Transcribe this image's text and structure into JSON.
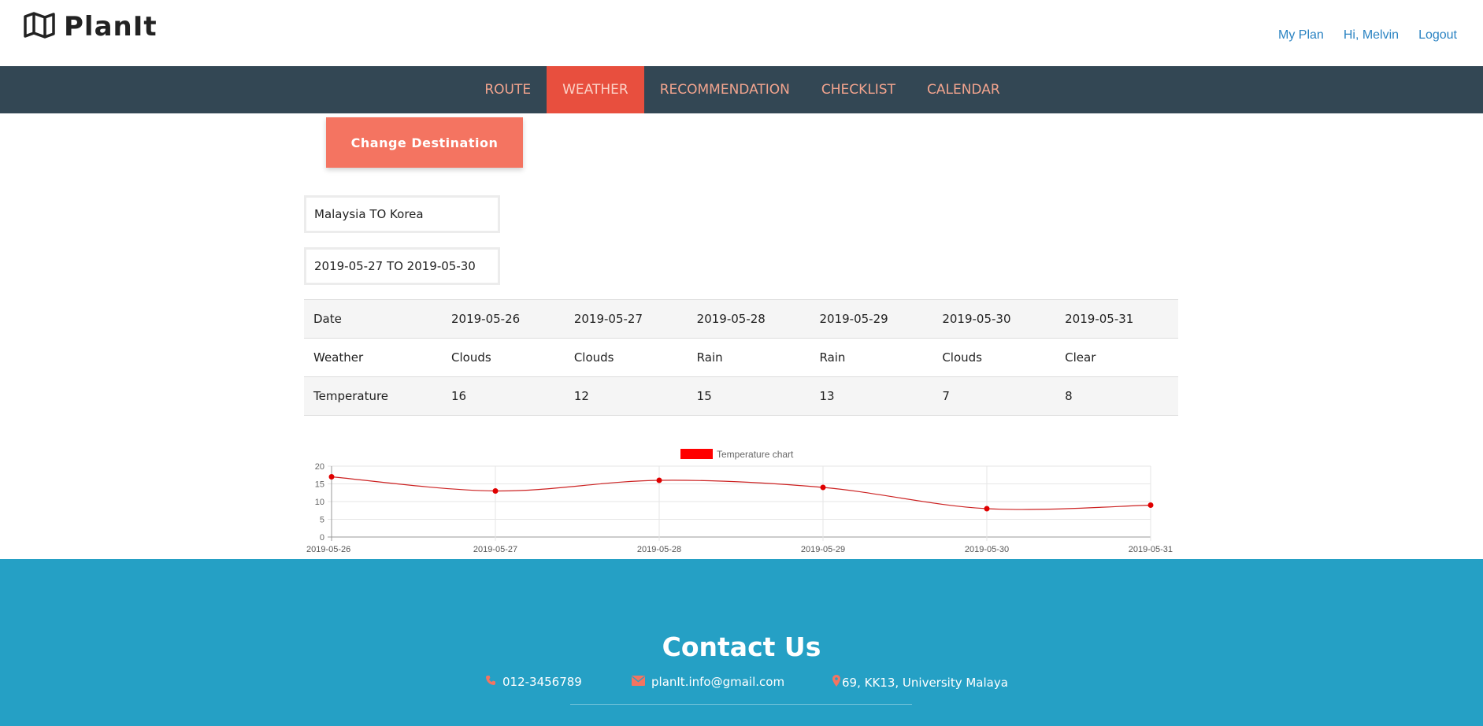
{
  "header": {
    "brand": "PlanIt",
    "links": [
      "My Plan",
      "Hi, Melvin",
      "Logout"
    ]
  },
  "nav": {
    "items": [
      "ROUTE",
      "WEATHER",
      "RECOMMENDATION",
      "CHECKLIST",
      "CALENDAR"
    ],
    "active": "WEATHER"
  },
  "main": {
    "change_destination": "Change Destination",
    "route": "Malaysia TO Korea",
    "dates": "2019-05-27 TO 2019-05-30"
  },
  "table": {
    "rows": [
      [
        "Date",
        "2019-05-26",
        "2019-05-27",
        "2019-05-28",
        "2019-05-29",
        "2019-05-30",
        "2019-05-31"
      ],
      [
        "Weather",
        "Clouds",
        "Clouds",
        "Rain",
        "Rain",
        "Clouds",
        "Clear"
      ],
      [
        "Temperature",
        "16",
        "12",
        "15",
        "13",
        "7",
        "8"
      ]
    ]
  },
  "chart_data": {
    "type": "line",
    "x": [
      "2019-05-26",
      "2019-05-27",
      "2019-05-28",
      "2019-05-29",
      "2019-05-30",
      "2019-05-31"
    ],
    "series": [
      {
        "name": "Temperature chart",
        "values": [
          17,
          13,
          16,
          14,
          8,
          9
        ]
      }
    ],
    "yticks": [
      "0",
      "5",
      "10",
      "15",
      "20"
    ],
    "ylim": [
      0,
      20
    ],
    "grid": true,
    "legend": "top-center",
    "color": "#ff0000"
  },
  "footer": {
    "title": "Contact Us",
    "phone": "012-3456789",
    "email": "planIt.info@gmail.com",
    "address": "69, KK13, University Malaya",
    "icon_color": "#f47461"
  }
}
